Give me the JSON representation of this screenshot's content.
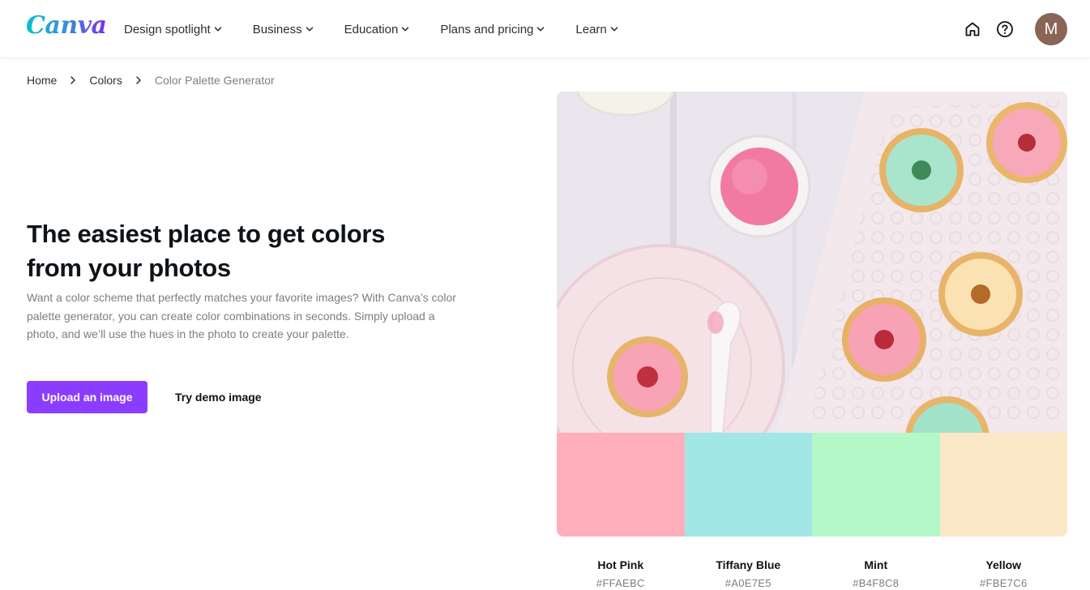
{
  "header": {
    "logo_text": "Canva",
    "nav": [
      {
        "label": "Design spotlight"
      },
      {
        "label": "Business"
      },
      {
        "label": "Education"
      },
      {
        "label": "Plans and pricing"
      },
      {
        "label": "Learn"
      }
    ],
    "avatar_initial": "M",
    "icons": [
      "home-icon",
      "help-icon"
    ]
  },
  "breadcrumb": {
    "items": [
      "Home",
      "Colors",
      "Color Palette Generator"
    ]
  },
  "hero": {
    "title_line1": "The easiest place to get colors",
    "title_line2": "from your photos",
    "description": "Want a color scheme that perfectly matches your favorite images? With Canva’s color palette generator, you can create color combinations in seconds. Simply upload a photo, and we’ll use the hues in the photo to create your palette.",
    "upload_label": "Upload an image",
    "demo_label": "Try demo image"
  },
  "palette": [
    {
      "name": "Hot Pink",
      "hex": "#FFAEBC"
    },
    {
      "name": "Tiffany Blue",
      "hex": "#A0E7E5"
    },
    {
      "name": "Mint",
      "hex": "#B4F8C8"
    },
    {
      "name": "Yellow",
      "hex": "#FBE7C6"
    }
  ],
  "colors": {
    "primary_button": "#8b3dff",
    "text": "#0e1318",
    "muted": "#7a7e84"
  }
}
